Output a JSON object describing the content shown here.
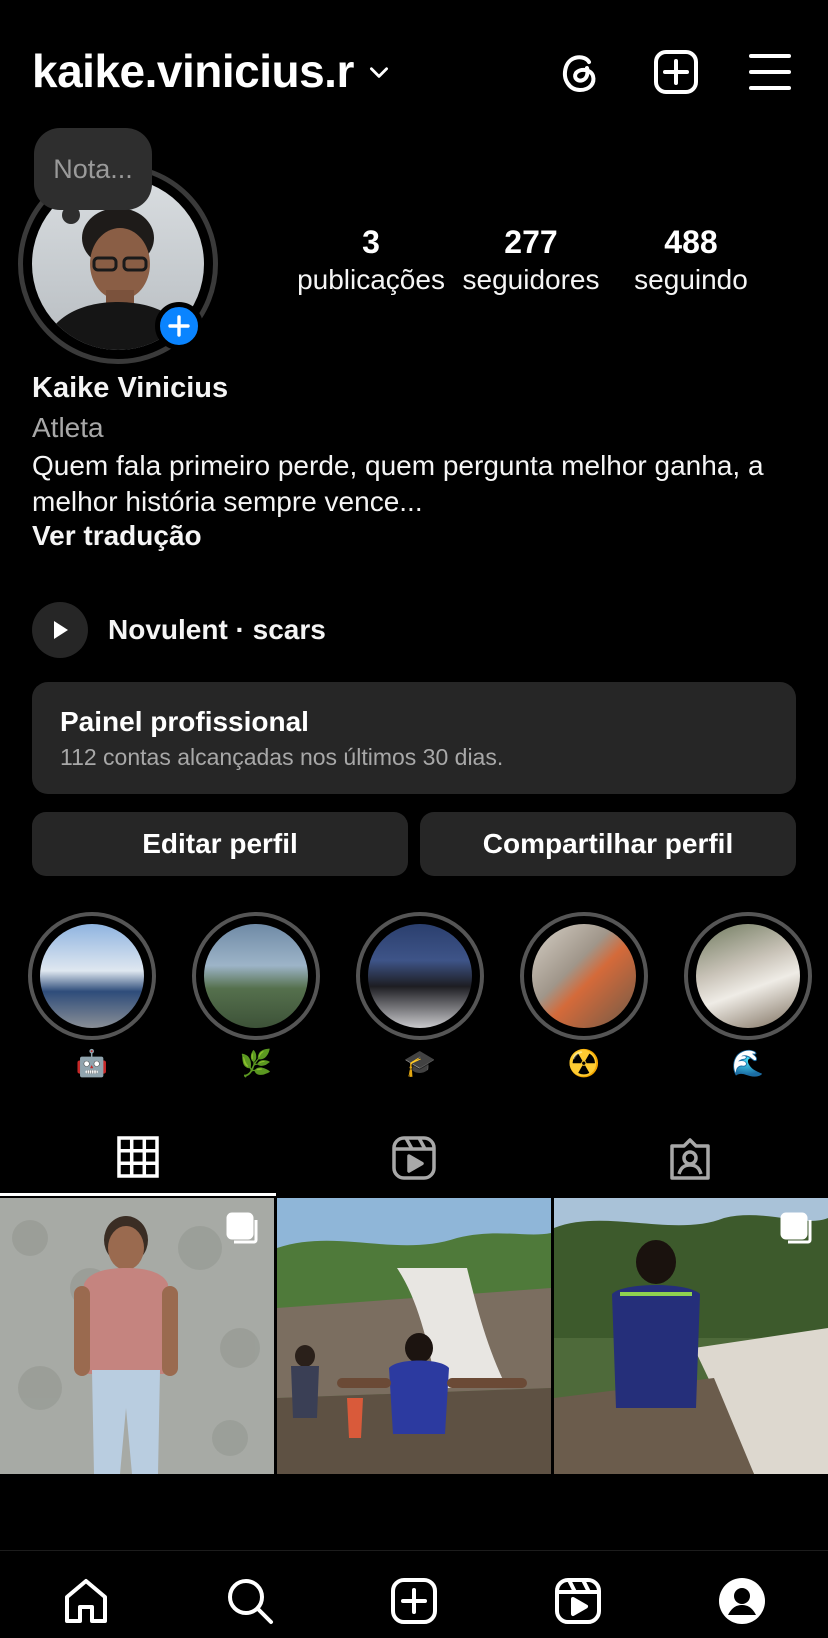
{
  "header": {
    "username": "kaike.vinicius.r",
    "icons": [
      "chevron-down-icon",
      "threads-icon",
      "create-icon",
      "menu-icon"
    ]
  },
  "profile": {
    "note_placeholder": "Nota...",
    "full_name": "Kaike Vinicius",
    "category": "Atleta",
    "bio": "Quem fala primeiro perde, quem pergunta melhor ganha, a melhor história sempre vence...",
    "see_translation": "Ver tradução",
    "stats": [
      {
        "value": "3",
        "label": "publicações"
      },
      {
        "value": "277",
        "label": "seguidores"
      },
      {
        "value": "488",
        "label": "seguindo"
      }
    ],
    "music": "Novulent · scars"
  },
  "dashboard": {
    "title": "Painel profissional",
    "subtitle": "112 contas alcançadas nos últimos 30 dias."
  },
  "actions": {
    "edit": "Editar perfil",
    "share": "Compartilhar perfil"
  },
  "highlights": [
    {
      "emoji": "🤖",
      "color": "#4f7bb0"
    },
    {
      "emoji": "🌿",
      "color": "#6d8a67"
    },
    {
      "emoji": "🎓",
      "color": "#3c4d72"
    },
    {
      "emoji": "☢️",
      "color": "#8a7a63"
    },
    {
      "emoji": "🌊",
      "color": "#a39a8a"
    }
  ],
  "tabs": [
    "grid-icon",
    "reels-icon",
    "tagged-icon"
  ],
  "bottom_nav": [
    "home-icon",
    "search-icon",
    "create-icon",
    "reels-icon",
    "profile-icon"
  ],
  "colors": {
    "background": "#000000",
    "surface": "#262626",
    "accent": "#0a84ff",
    "secondary_text": "#a8a8a8"
  }
}
